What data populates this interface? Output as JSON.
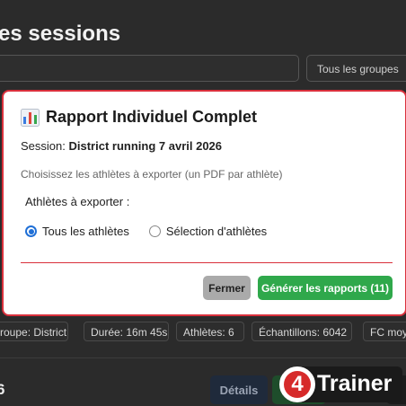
{
  "background": {
    "page_title": "es sessions",
    "group_filter": "Tous les groupes",
    "chips": [
      "roupe: District",
      "Durée: 16m 45s",
      "Athlètes: 6",
      "Échantillons: 6042",
      "FC moy"
    ],
    "count": "6",
    "details_button": "Détails"
  },
  "logo": {
    "number": "4",
    "text": "Trainer"
  },
  "modal": {
    "title": "Rapport Individuel Complet",
    "session_label": "Session:",
    "session_name": "District running 7 avril 2026",
    "instructions": "Choisissez les athlètes à exporter (un PDF par athlète)",
    "athletes_label": "Athlètes à exporter :",
    "options": [
      {
        "label": "Tous les athlètes",
        "checked": true
      },
      {
        "label": "Sélection d'athlètes",
        "checked": false
      }
    ],
    "close_button": "Fermer",
    "generate_button": "Générer les rapports (11)"
  },
  "colors": {
    "accent_red": "#d9303c",
    "generate_green": "#2fa84b",
    "radio_blue": "#1f6fd6"
  }
}
